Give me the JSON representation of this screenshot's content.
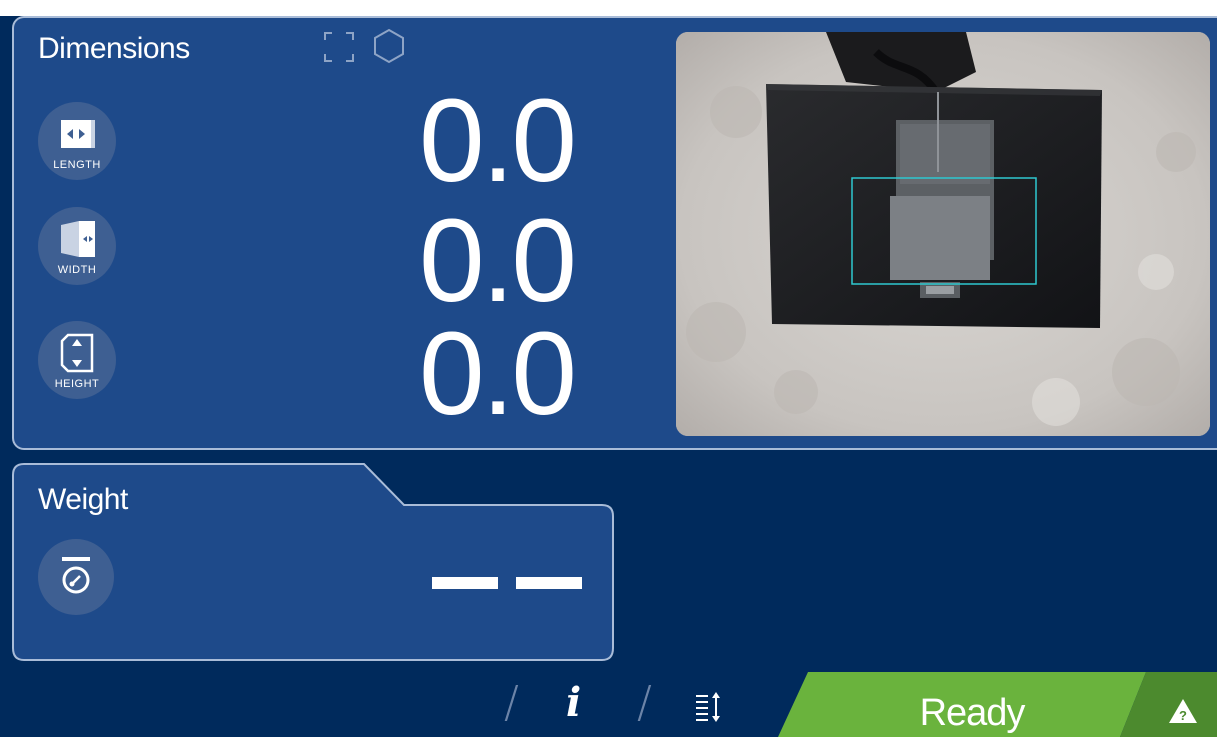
{
  "dimensions": {
    "title": "Dimensions",
    "mode_icons": [
      "box-outline-icon",
      "hexagon-icon"
    ],
    "length": {
      "label": "LENGTH",
      "value": "0.0",
      "icon": "length-icon"
    },
    "width": {
      "label": "WIDTH",
      "value": "0.0",
      "icon": "width-icon"
    },
    "height": {
      "label": "HEIGHT",
      "value": "0.0",
      "icon": "height-icon"
    }
  },
  "weight": {
    "title": "Weight",
    "icon": "scale-icon",
    "value": "— —"
  },
  "toolbar": {
    "info_label": "i",
    "sort_icon": "sort-list-icon",
    "status": "Ready",
    "warning_icon": "warning-help-icon"
  },
  "colors": {
    "background": "#002a5c",
    "panel": "#1e4a8a",
    "icon_circle": "#3e5f92",
    "status_green": "#6ab33d",
    "status_green_dark": "#4c8a2e",
    "roi_box": "#2ec8d0"
  }
}
